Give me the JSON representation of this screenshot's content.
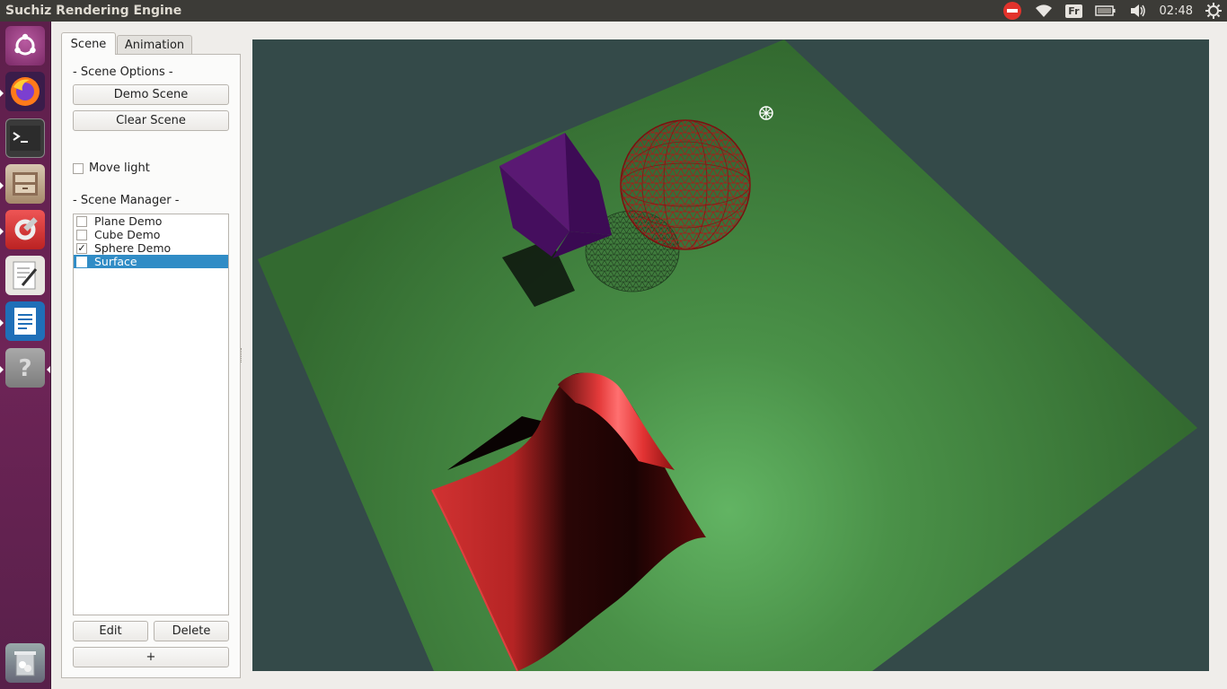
{
  "window": {
    "title": "Suchiz Rendering Engine"
  },
  "tray": {
    "keyboard_layout": "Fr",
    "time": "02:48",
    "icons": [
      "stop-icon",
      "wifi-icon",
      "keyboard-layout-indicator",
      "battery-icon",
      "volume-icon",
      "gear-icon"
    ]
  },
  "launcher": {
    "items": [
      "ubuntu-dash-icon",
      "firefox-icon",
      "terminal-icon",
      "files-icon",
      "system-settings-icon",
      "text-editor-icon",
      "writer-icon",
      "help-icon",
      "trash-icon"
    ]
  },
  "tabs": {
    "scene": "Scene",
    "animation": "Animation"
  },
  "scene_options": {
    "title": "- Scene Options -",
    "demo_scene": "Demo Scene",
    "clear_scene": "Clear Scene",
    "move_light": "Move light",
    "move_light_checked": false
  },
  "scene_manager": {
    "title": "- Scene Manager -",
    "items": [
      {
        "label": "Plane Demo",
        "checked": false
      },
      {
        "label": "Cube Demo",
        "checked": false
      },
      {
        "label": "Sphere Demo",
        "checked": true
      },
      {
        "label": "Surface",
        "checked": false,
        "selected": true
      }
    ],
    "edit": "Edit",
    "delete": "Delete",
    "add": "+"
  },
  "colors": {
    "viewport_bg": "#344a49",
    "plane": "#3b7a3a",
    "cube": "#4e1263",
    "sphere": "#c42020",
    "surface": "#d83333",
    "selection": "#308cc6",
    "launcher": "#6e2457"
  }
}
